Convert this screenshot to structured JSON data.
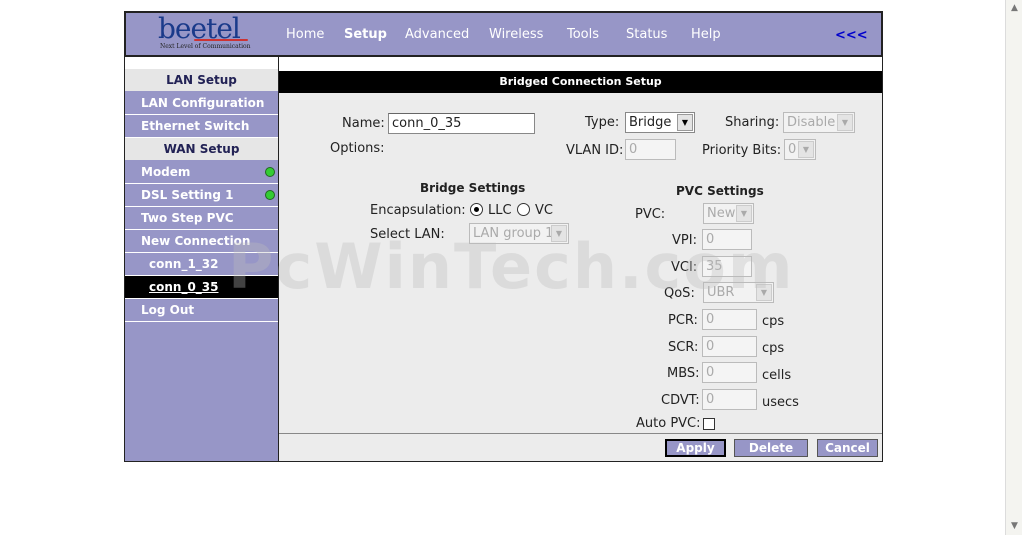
{
  "logo": {
    "brand": "beetel",
    "tagline": "Next Level of Communication"
  },
  "nav": {
    "items": [
      "Home",
      "Setup",
      "Advanced",
      "Wireless",
      "Tools",
      "Status",
      "Help"
    ],
    "active": "Setup",
    "back_label": "<<<"
  },
  "sidebar": {
    "lan_setup": "LAN Setup",
    "lan_configuration": "LAN Configuration",
    "ethernet_switch": "Ethernet Switch",
    "wan_setup": "WAN Setup",
    "modem": "Modem",
    "dsl_setting": "DSL Setting 1",
    "two_step_pvc": "Two Step PVC",
    "new_connection": "New Connection",
    "conn_1": "conn_1_32",
    "conn_2": "conn_0_35",
    "log_out": "Log Out",
    "status_color": "#33cc33"
  },
  "form": {
    "title": "Bridged Connection Setup",
    "name_label": "Name:",
    "name_value": "conn_0_35",
    "type_label": "Type:",
    "type_value": "Bridge",
    "sharing_label": "Sharing:",
    "sharing_value": "Disable",
    "options_label": "Options:",
    "vlan_label": "VLAN ID:",
    "vlan_value": "0",
    "priority_label": "Priority Bits:",
    "priority_value": "0",
    "bridge_header": "Bridge Settings",
    "encap_label": "Encapsulation:",
    "encap_llc": "LLC",
    "encap_vc": "VC",
    "encap_selected": "LLC",
    "select_lan_label": "Select LAN:",
    "select_lan_value": "LAN group 1",
    "pvc_header": "PVC Settings",
    "pvc_label": "PVC:",
    "pvc_value": "New",
    "vpi_label": "VPI:",
    "vpi_value": "0",
    "vci_label": "VCI:",
    "vci_value": "35",
    "qos_label": "QoS:",
    "qos_value": "UBR",
    "pcr_label": "PCR:",
    "pcr_value": "0",
    "pcr_unit": "cps",
    "scr_label": "SCR:",
    "scr_value": "0",
    "scr_unit": "cps",
    "mbs_label": "MBS:",
    "mbs_value": "0",
    "mbs_unit": "cells",
    "cdvt_label": "CDVT:",
    "cdvt_value": "0",
    "cdvt_unit": "usecs",
    "auto_pvc_label": "Auto PVC:"
  },
  "buttons": {
    "apply": "Apply",
    "delete": "Delete",
    "cancel": "Cancel"
  },
  "watermark": "PcWinTech.com"
}
